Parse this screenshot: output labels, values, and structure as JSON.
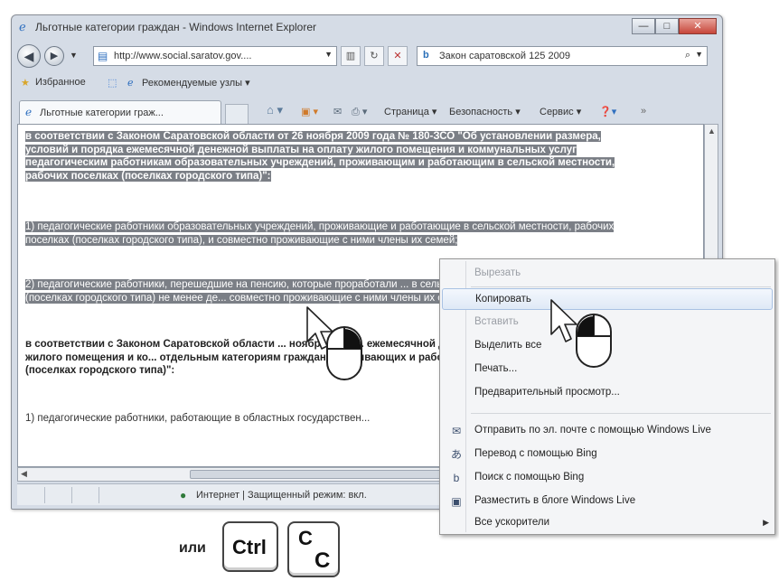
{
  "window": {
    "title": "Льготные категории граждан - Windows Internet Explorer",
    "caption": {
      "minimize": "—",
      "maximize": "□",
      "close": "✕"
    }
  },
  "address_bar": {
    "url": "http://www.social.saratov.gov....",
    "search_text": "Закон саратовской 125  2009"
  },
  "favorites_bar": {
    "favorites": "Избранное",
    "suggested": "Рекомендуемые узлы ▾"
  },
  "tab": {
    "label": "Льготные категории граж..."
  },
  "command_bar": {
    "page": "Страница ▾",
    "security": "Безопасность ▾",
    "tools": "Сервис ▾"
  },
  "content": {
    "para1": "в соответствии с Законом Саратовской области от 26 ноября 2009 года № 180-ЗСО \"Об установлении размера, условий и порядка ежемесячной денежной выплаты на оплату жилого помещения и коммунальных услуг педагогическим работникам образовательных учреждений, проживающим и работающим в сельской местности, рабочих поселках (поселках городского типа)\":",
    "para2": "1) педагогические работники образовательных учреждений, проживающие и работающие в сельской местности, рабочих поселках (поселках городского типа), и совместно проживающие с ними члены их семей;",
    "para3": "2) педагогические работники, перешедшие на пенсию, которые проработали ... в сельской местности, рабочих поселках (поселках городского типа) не менее де... совместно проживающие с ними члены их семей;",
    "para4": "в соответствии с Законом Саратовской области ... ноября 2009 ... ежемесячной денежной выплате на оплату жилого помещения и ко... отдельным категориям граждан, проживающих и работающих в сел... поселках (поселках городского типа)\":",
    "para5": "1) педагогические работники, работающие в областных государствен..."
  },
  "status_bar": {
    "zone": "Интернет | Защищенный режим: вкл."
  },
  "context_menu": {
    "items": [
      {
        "label": "Вырезать",
        "disabled": true,
        "icon": ""
      },
      {
        "label": "Копировать",
        "disabled": false,
        "icon": ""
      },
      {
        "label": "Вставить",
        "disabled": true,
        "icon": ""
      },
      {
        "label": "Выделить все",
        "disabled": false,
        "icon": ""
      },
      {
        "label": "Печать...",
        "disabled": false,
        "icon": ""
      },
      {
        "label": "Предварительный просмотр...",
        "disabled": false,
        "icon": ""
      },
      {
        "label": "Отправить по эл. почте с помощью Windows Live",
        "disabled": false,
        "icon": "mail-icon"
      },
      {
        "label": "Перевод с помощью Bing",
        "disabled": false,
        "icon": "translate-icon"
      },
      {
        "label": "Поиск с помощью Bing",
        "disabled": false,
        "icon": "bing-icon"
      },
      {
        "label": "Разместить в блоге Windows Live",
        "disabled": false,
        "icon": "blog-icon"
      },
      {
        "label": "Все ускорители",
        "disabled": false,
        "icon": ""
      }
    ]
  },
  "shortcut": {
    "or_label": "или",
    "key1": "Ctrl",
    "key2_upper": "C",
    "key2_lower": "C"
  }
}
